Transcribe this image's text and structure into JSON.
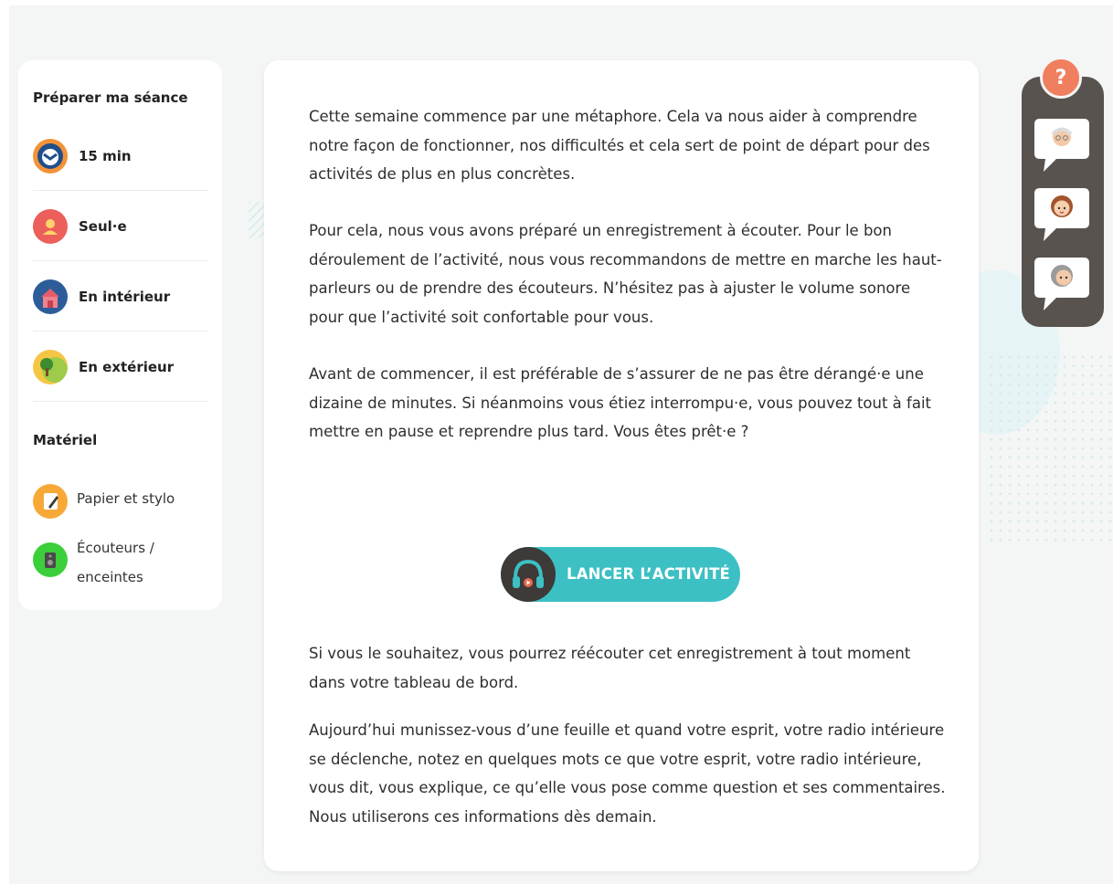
{
  "sidebar": {
    "prepare_title": "Préparer ma séance",
    "items": [
      {
        "label": "15 min",
        "icon": "clock-icon"
      },
      {
        "label": "Seul·e",
        "icon": "person-icon"
      },
      {
        "label": "En intérieur",
        "icon": "house-icon"
      },
      {
        "label": "En extérieur",
        "icon": "tree-icon"
      }
    ],
    "material_title": "Matériel",
    "materials": [
      {
        "label": "Papier et stylo",
        "icon": "notepad-icon"
      },
      {
        "label": "Écouteurs / enceintes",
        "icon": "speaker-icon"
      }
    ]
  },
  "main": {
    "paragraphs": [
      "Cette semaine commence par une métaphore. Cela va nous aider à comprendre notre façon de fonctionner, nos difficultés et cela sert de point de départ pour des activités de plus en plus concrètes.",
      "Pour cela, nous vous avons préparé un enregistrement à écouter. Pour le bon déroulement de l’activité, nous vous recommandons de mettre en marche les haut-parleurs ou de prendre des écouteurs. N’hésitez pas à ajuster le volume sonore pour que l’activité soit confortable pour vous.",
      "Avant de commencer, il est préférable de s’assurer de ne pas être dérangé·e une dizaine de minutes. Si néanmoins vous étiez interrompu·e, vous pouvez tout à fait mettre en pause et reprendre plus tard. Vous êtes prêt·e ?",
      "Si vous le souhaitez, vous pourrez réécouter cet enregistrement à tout moment dans votre tableau de bord.",
      "Aujourd’hui munissez-vous d’une feuille et quand votre esprit, votre radio intérieure se déclenche, notez en quelques mots ce que votre esprit, votre radio intérieure, vous dit, vous explique, ce qu’elle vous pose comme question et ses commentaires. Nous utiliserons ces informations dès demain."
    ],
    "launch_label": "LANCER L’ACTIVITÉ"
  },
  "help": {
    "symbol": "?"
  },
  "colors": {
    "accent": "#3cc0c4",
    "help": "#f07f5f",
    "panel": "#58534e"
  }
}
